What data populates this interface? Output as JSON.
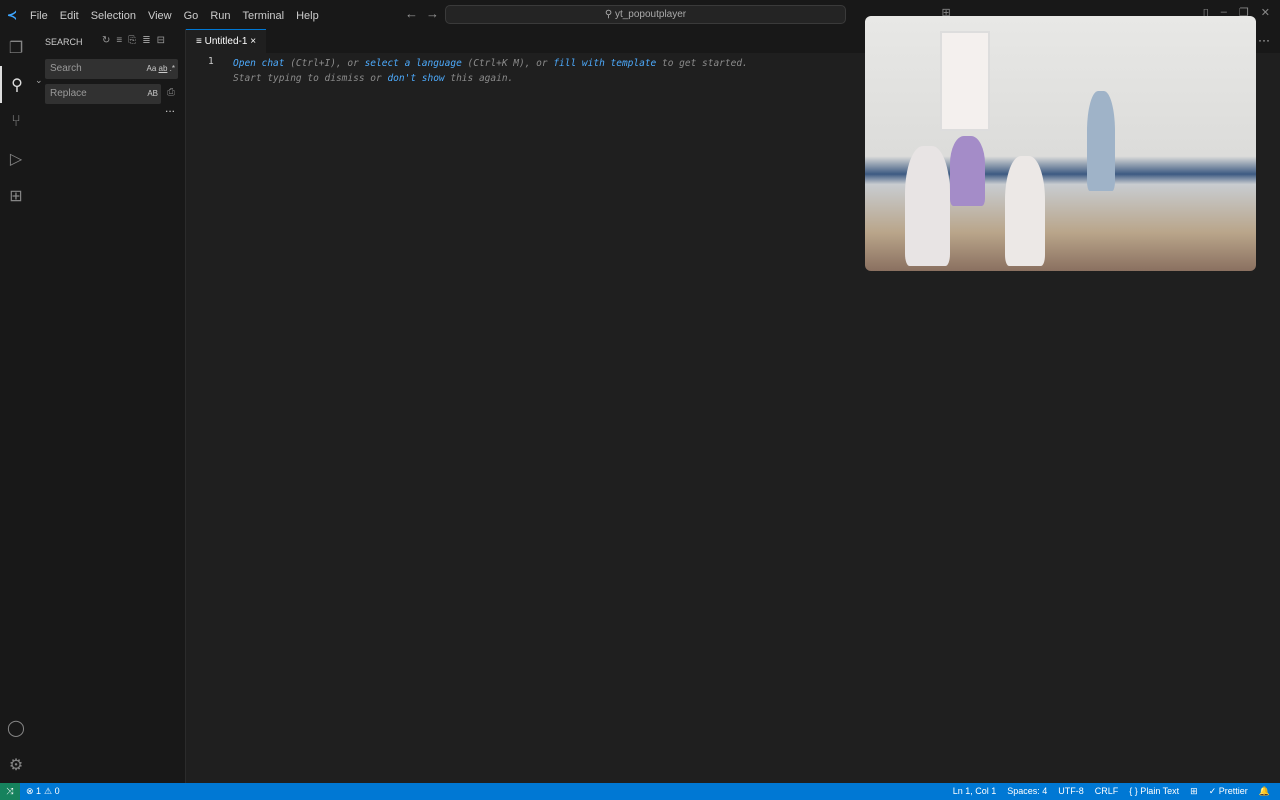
{
  "menu": [
    "File",
    "Edit",
    "Selection",
    "View",
    "Go",
    "Run",
    "Terminal",
    "Help"
  ],
  "command_center": "yt_popoutplayer",
  "sidebar": {
    "title": "SEARCH",
    "search_placeholder": "Search",
    "replace_placeholder": "Replace",
    "match_case": "Aa",
    "whole_word": "ab",
    "regex": ".*",
    "preserve_case": "AB",
    "more": "..."
  },
  "tab": {
    "label": "Untitled-1",
    "close": "×"
  },
  "editor": {
    "line_number": "1",
    "hint": {
      "open_chat": "Open chat",
      "p1": " (Ctrl+I), or ",
      "select_language": "select a language",
      "p2": " (Ctrl+K M), or ",
      "fill_template": "fill with template",
      "p3": " to get started.",
      "line2a": "Start typing to dismiss or ",
      "dont_show": "don't show",
      "line2b": " this again."
    }
  },
  "status": {
    "remote": "⤨",
    "errors": "⊗ 1",
    "warnings": "⚠ 0",
    "position": "Ln 1, Col 1",
    "spaces": "Spaces: 4",
    "encoding": "UTF-8",
    "eol": "CRLF",
    "language": "{ } Plain Text",
    "prettier": "✓ Prettier",
    "bell": "🔔"
  }
}
